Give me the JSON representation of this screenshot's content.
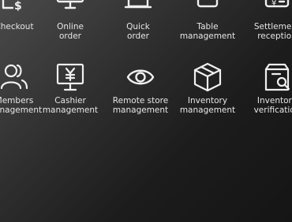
{
  "row1": [
    {
      "icon": "checkout-icon",
      "line1": "Checkout",
      "line2": ""
    },
    {
      "icon": "online-order-icon",
      "line1": "Online",
      "line2": "order"
    },
    {
      "icon": "quick-order-icon",
      "line1": "Quick",
      "line2": "order"
    },
    {
      "icon": "table-management-icon",
      "line1": "Table",
      "line2": "management"
    },
    {
      "icon": "settlement-reception-icon",
      "line1": "Settlement",
      "line2": "reception"
    }
  ],
  "row2": [
    {
      "icon": "members-icon",
      "line1": "Members",
      "line2": "management"
    },
    {
      "icon": "cashier-icon",
      "line1": "Cashier",
      "line2": "management"
    },
    {
      "icon": "eye-icon",
      "line1": "Remote store",
      "line2": "management"
    },
    {
      "icon": "box-icon",
      "line1": "Inventory",
      "line2": "management"
    },
    {
      "icon": "inventory-verification-icon",
      "line1": "Inventory",
      "line2": "verification"
    }
  ]
}
